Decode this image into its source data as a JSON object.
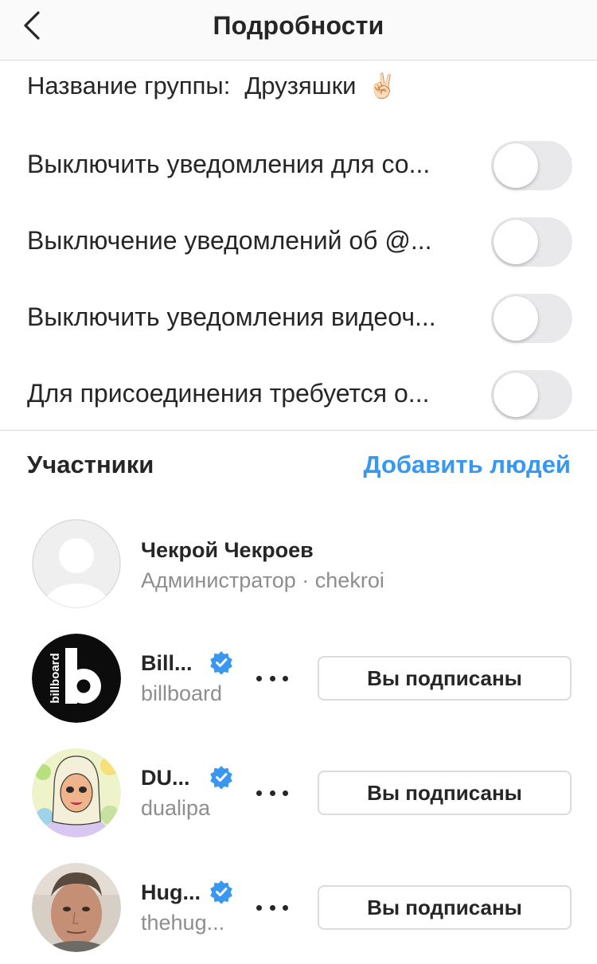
{
  "header": {
    "title": "Подробности",
    "back_icon": "chevron-left-icon"
  },
  "group": {
    "label": "Название группы:",
    "name": "Друзяшки",
    "emoji": "✌🏻"
  },
  "settings": [
    {
      "label": "Выключить уведомления для со...",
      "enabled": false
    },
    {
      "label": "Выключение уведомлений об @...",
      "enabled": false
    },
    {
      "label": "Выключить уведомления видеоч...",
      "enabled": false
    },
    {
      "label": "Для присоединения требуется о...",
      "enabled": false
    }
  ],
  "members": {
    "title": "Участники",
    "add_label": "Добавить людей",
    "add_color": "#3897f0",
    "list": [
      {
        "name": "Чекрой Чекроев",
        "subtitle": "Администратор · chekroi",
        "avatar": "default-avatar-icon",
        "verified": false
      },
      {
        "name": "Bill...",
        "subtitle": "billboard",
        "avatar": "billboard-logo",
        "verified": true,
        "button": "Вы подписаны"
      },
      {
        "name": "DU...",
        "subtitle": "dualipa",
        "avatar": "cartoon-avatar",
        "verified": true,
        "button": "Вы подписаны"
      },
      {
        "name": "Hug...",
        "subtitle": "thehug...",
        "avatar": "photo-avatar",
        "verified": true,
        "button": "Вы подписаны"
      }
    ]
  },
  "colors": {
    "verified_badge": "#3897f0",
    "toggle_off": "#e9e9eb"
  }
}
